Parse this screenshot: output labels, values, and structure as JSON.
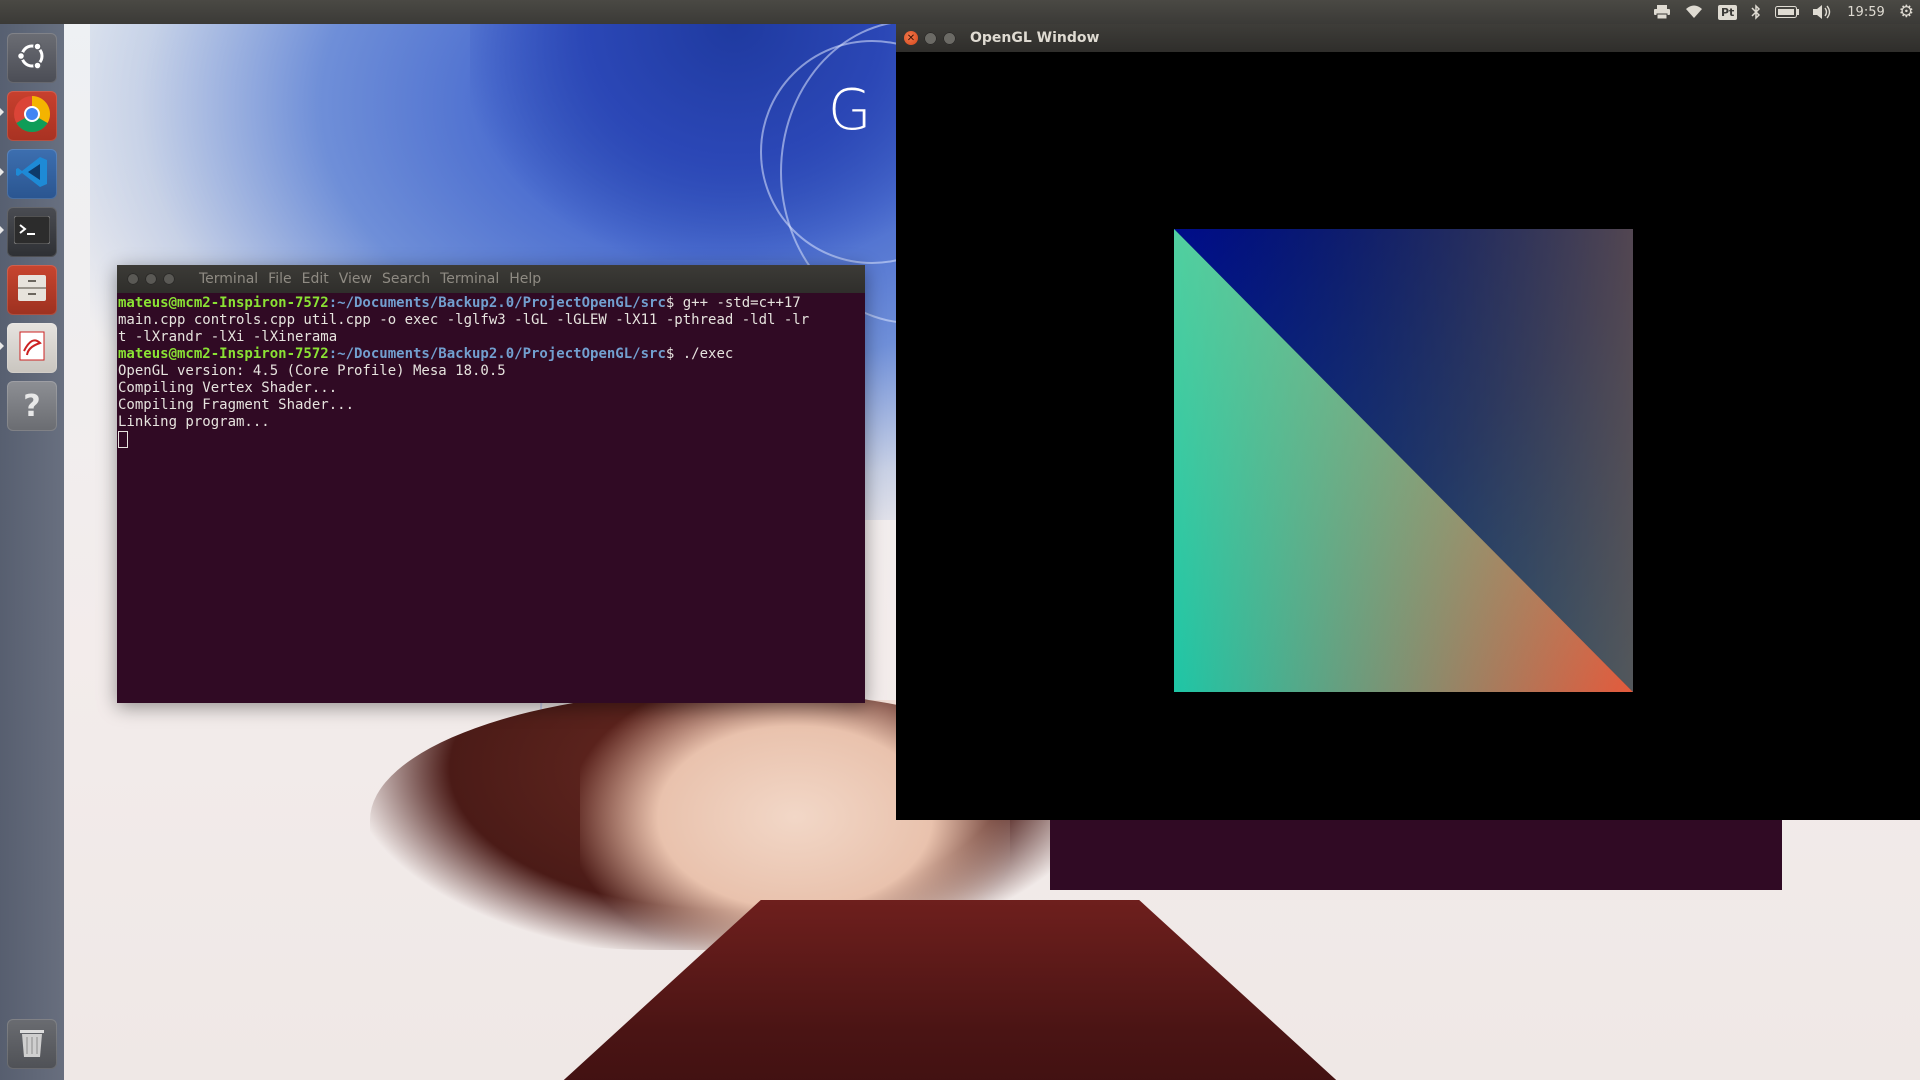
{
  "top_panel": {
    "tray_icons": [
      "printer-icon",
      "wifi-icon",
      "keyboard-layout-icon",
      "bluetooth-icon",
      "battery-icon",
      "volume-icon",
      "system-gear-icon"
    ],
    "keyboard_layout": "Pt",
    "clock": "19:59"
  },
  "launcher": {
    "items": [
      {
        "name": "ubuntu-dash",
        "icon": "ubuntu-logo-icon"
      },
      {
        "name": "chrome",
        "icon": "chrome-icon"
      },
      {
        "name": "vscode",
        "icon": "vscode-icon"
      },
      {
        "name": "terminal",
        "icon": "terminal-icon"
      },
      {
        "name": "files",
        "icon": "file-cabinet-icon"
      },
      {
        "name": "evince",
        "icon": "document-viewer-icon"
      },
      {
        "name": "help",
        "icon": "help-icon"
      },
      {
        "name": "trash",
        "icon": "trash-icon"
      }
    ]
  },
  "wallpaper": {
    "glyph": "G"
  },
  "terminal": {
    "menu": [
      "Terminal",
      "File",
      "Edit",
      "View",
      "Search",
      "Terminal",
      "Help"
    ],
    "lines": [
      {
        "user": "mateus@mcm2-Inspiron-7572",
        "path": ":~/Documents/Backup2.0/ProjectOpenGL/src",
        "cmd": "$ g++ -std=c++17"
      },
      {
        "text": "main.cpp controls.cpp util.cpp -o exec -lglfw3 -lGL -lGLEW -lX11 -pthread -ldl -lr"
      },
      {
        "text": "t -lXrandr -lXi -lXinerama"
      },
      {
        "user": "mateus@mcm2-Inspiron-7572",
        "path": ":~/Documents/Backup2.0/ProjectOpenGL/src",
        "cmd": "$ ./exec"
      },
      {
        "text": "OpenGL version: 4.5 (Core Profile) Mesa 18.0.5"
      },
      {
        "text": "Compiling Vertex Shader..."
      },
      {
        "text": "Compiling Fragment Shader..."
      },
      {
        "text": "Linking program..."
      }
    ],
    "colors": {
      "bg": "#300a24",
      "user": "#8ae234",
      "path": "#729fcf"
    }
  },
  "opengl_window": {
    "title": "OpenGL Window",
    "colors": {
      "top_left": "#000c8a",
      "top_right": "#6a4a3a",
      "bottom_left": "#1ec6a6",
      "bottom_right": "#e45a3c",
      "upper_right_blend": "#0e7fbf"
    }
  }
}
